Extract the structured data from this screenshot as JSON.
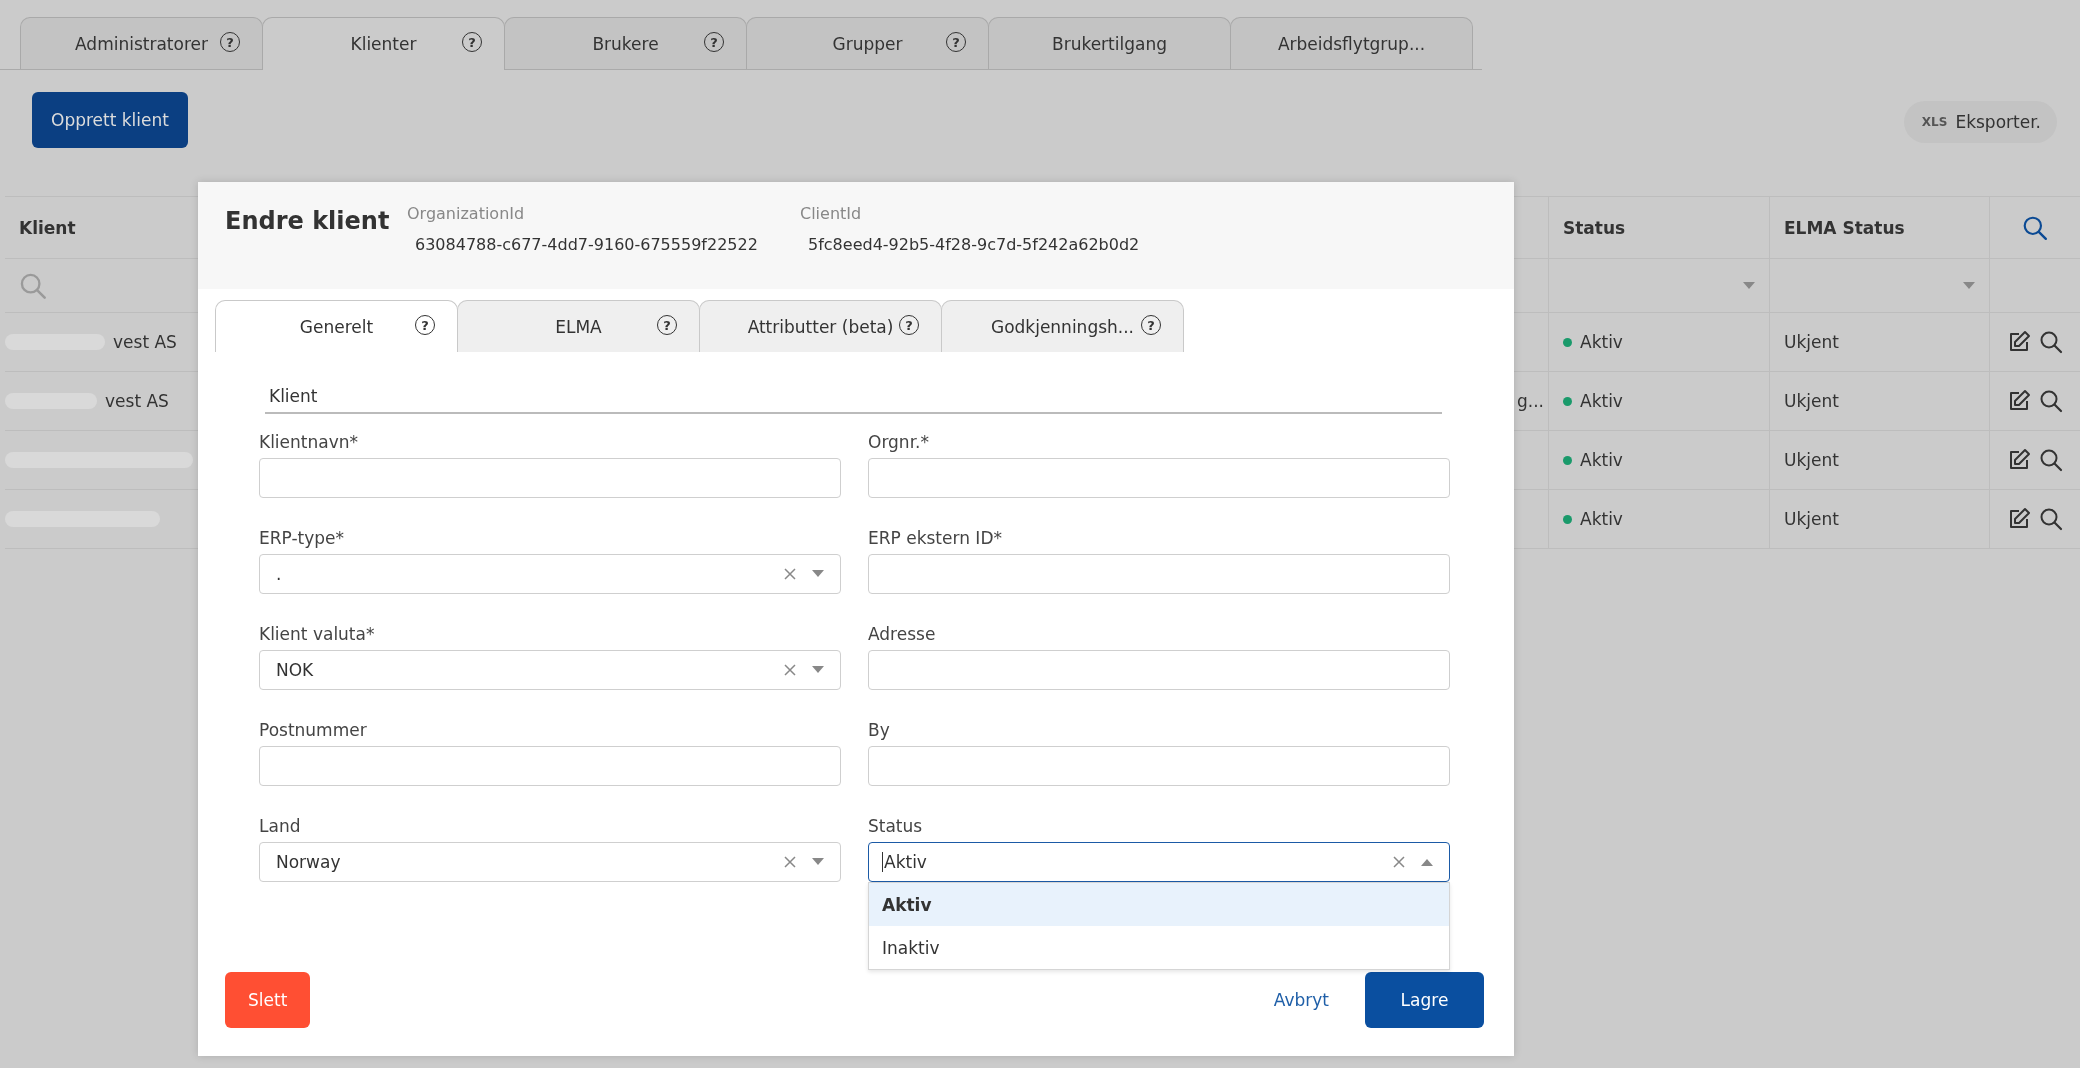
{
  "tabs": [
    {
      "label": "Administratorer",
      "help": "?",
      "selected": false
    },
    {
      "label": "Klienter",
      "help": "?",
      "selected": true
    },
    {
      "label": "Brukere",
      "help": "?",
      "selected": false
    },
    {
      "label": "Grupper",
      "help": "?",
      "selected": false
    },
    {
      "label": "Brukertilgang",
      "selected": false
    },
    {
      "label": "Arbeidsflytgrup...",
      "selected": false
    }
  ],
  "create_button": "Opprett klient",
  "export_button": {
    "badge": "XLS",
    "label": "Eksporter."
  },
  "table": {
    "columns": [
      {
        "label": "Klient",
        "kind": "search"
      },
      {
        "label": "Status",
        "kind": "dropdown"
      },
      {
        "label": "ELMA Status",
        "kind": "dropdown"
      }
    ],
    "rows": [
      {
        "client_name": "vest AS",
        "redacted": true,
        "status": "Aktiv",
        "color": "#1a9a6b",
        "elma_status": "Ukjent"
      },
      {
        "client_name": "vest AS",
        "redacted": true,
        "column_2": "g...",
        "status": "Aktiv",
        "color": "#1a9a6b",
        "elma_status": "Ukjent"
      },
      {
        "redacted": true,
        "status": "Aktiv",
        "color": "#1a9a6b",
        "elma_status": "Ukjent"
      },
      {
        "redacted": true,
        "status": "Aktiv",
        "color": "#1a9a6b",
        "elma_status": "Ukjent"
      }
    ]
  },
  "dialog": {
    "title": "Endre klient",
    "meta": [
      {
        "label": "OrganizationId",
        "value": "63084788-c677-4dd7-9160-675559f22522"
      },
      {
        "label": "ClientId",
        "value": "5fc8eed4-92b5-4f28-9c7d-5f242a62b0d2"
      }
    ],
    "tabs": [
      {
        "label": "Generelt",
        "help": "?",
        "selected": true
      },
      {
        "label": "ELMA",
        "help": "?",
        "selected": false
      },
      {
        "label": "Attributter (beta)",
        "help": "?",
        "selected": false
      },
      {
        "label": "Godkjenningsh...",
        "help": "?",
        "selected": false
      }
    ],
    "section": "Klient",
    "fields": [
      {
        "label": "Klientnavn*",
        "kind": "text"
      },
      {
        "label": "Orgnr.*",
        "kind": "text"
      },
      {
        "label": "ERP-type*",
        "kind": "select",
        "value": ".",
        "open": false
      },
      {
        "label": "ERP ekstern ID*",
        "kind": "text"
      },
      {
        "label": "Klient valuta*",
        "kind": "select",
        "value": "NOK",
        "open": false
      },
      {
        "label": "Adresse",
        "kind": "text"
      },
      {
        "label": "Postnummer",
        "kind": "text"
      },
      {
        "label": "By",
        "kind": "text"
      },
      {
        "label": "Land",
        "kind": "select",
        "value": "Norway",
        "open": false
      },
      {
        "label": "Status",
        "kind": "select",
        "value": "Aktiv",
        "open": true,
        "options": [
          {
            "label": "Aktiv",
            "selected": true
          },
          {
            "label": "Inaktiv",
            "selected": false
          }
        ]
      }
    ],
    "delete_button": "Slett",
    "cancel_link": "Avbryt",
    "save_button": "Lagre"
  }
}
